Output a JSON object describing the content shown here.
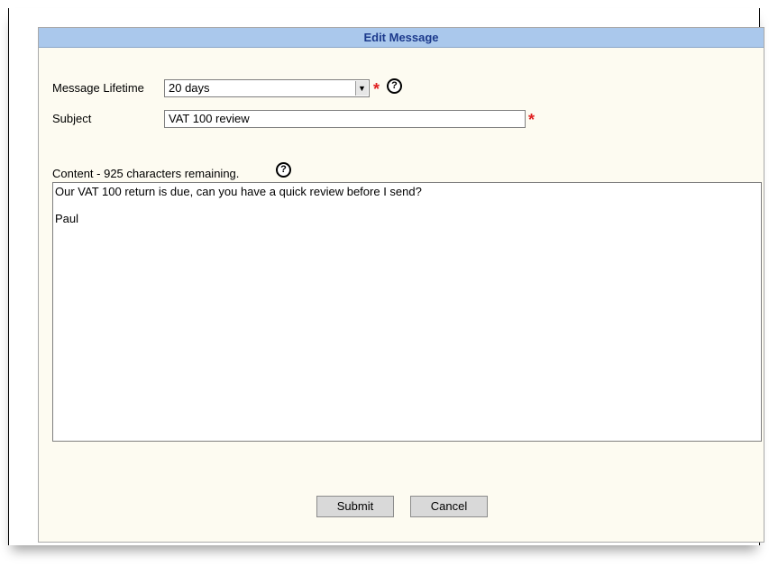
{
  "dialog": {
    "title": "Edit Message"
  },
  "form": {
    "lifetime_label": "Message Lifetime",
    "lifetime_value": "20 days",
    "subject_label": "Subject",
    "subject_value": "VAT 100 review",
    "content_label": "Content  - 925 characters remaining.",
    "content_lines": [
      "Our VAT 100 return is due, can you have a quick review before I send?",
      "",
      "Paul"
    ],
    "required_mark": "*",
    "help_glyph": "?"
  },
  "buttons": {
    "submit_label": "Submit",
    "cancel_label": "Cancel"
  },
  "icons": {
    "help": "question-circle-icon",
    "dropdown": "chevron-down-icon",
    "required": "asterisk-icon"
  },
  "colors": {
    "header_bg": "#aac8ec",
    "header_text": "#1c3a8c",
    "dialog_bg": "#fdfbf1",
    "required": "#e02020"
  }
}
